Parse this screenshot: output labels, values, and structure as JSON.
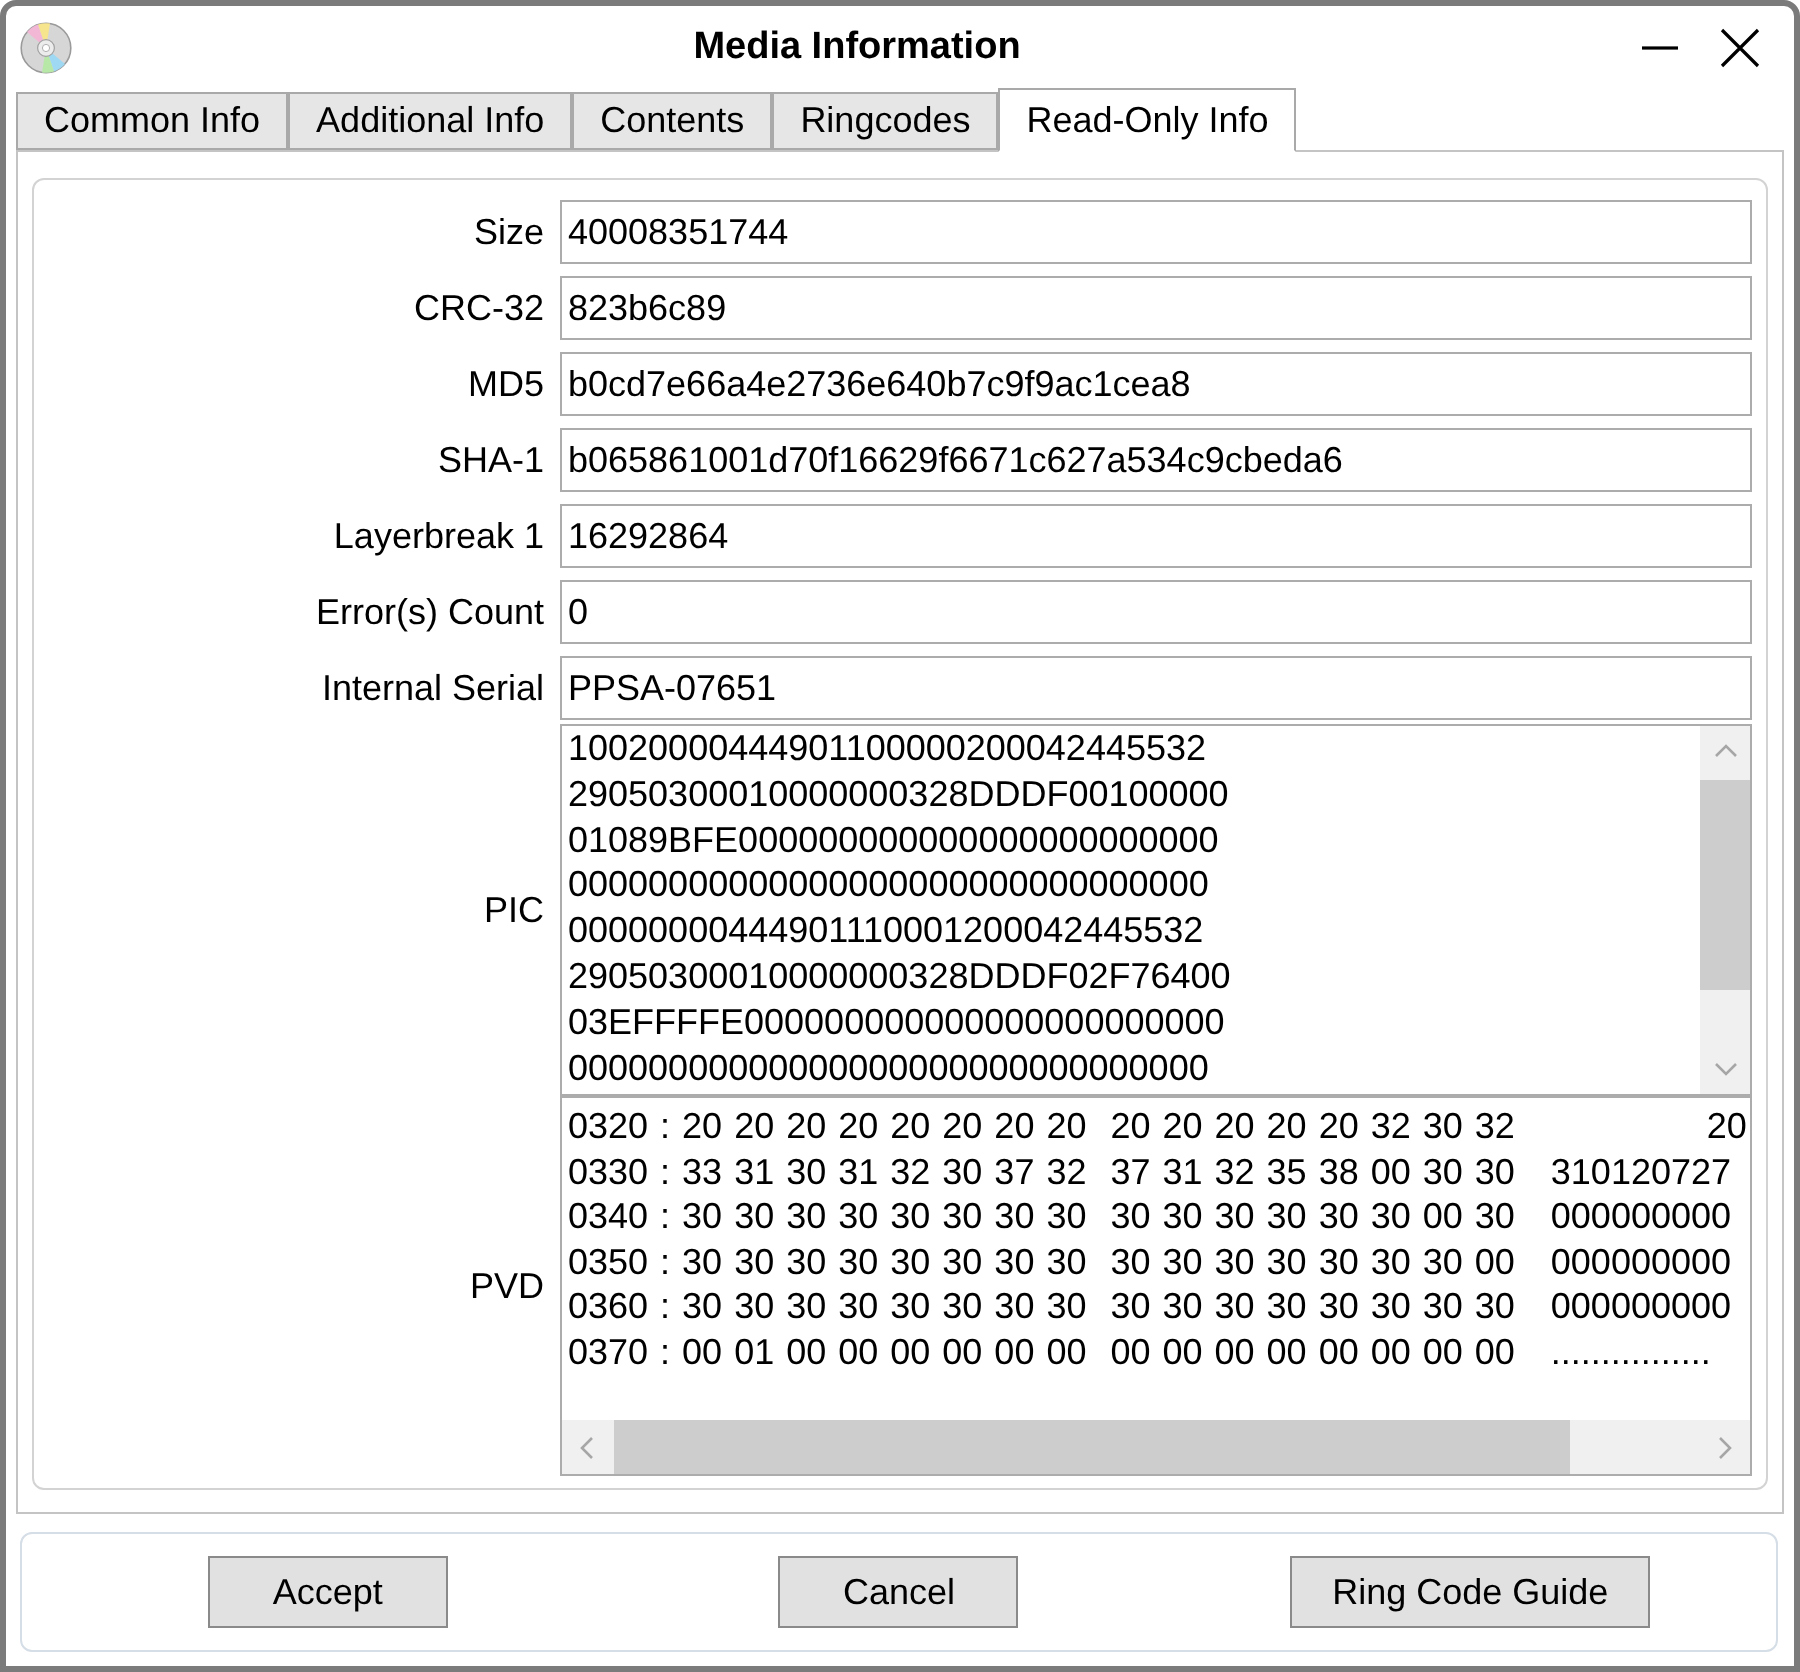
{
  "window": {
    "title": "Media Information"
  },
  "tabs": [
    {
      "label": "Common Info",
      "selected": false
    },
    {
      "label": "Additional Info",
      "selected": false
    },
    {
      "label": "Contents",
      "selected": false
    },
    {
      "label": "Ringcodes",
      "selected": false
    },
    {
      "label": "Read-Only Info",
      "selected": true
    }
  ],
  "fields": [
    {
      "label": "Size",
      "value": "40008351744"
    },
    {
      "label": "CRC-32",
      "value": "823b6c89"
    },
    {
      "label": "MD5",
      "value": "b0cd7e66a4e2736e640b7c9f9ac1cea8"
    },
    {
      "label": "SHA-1",
      "value": "b065861001d70f16629f6671c627a534c9cbeda6"
    },
    {
      "label": "Layerbreak 1",
      "value": "16292864"
    },
    {
      "label": "Error(s) Count",
      "value": "0"
    },
    {
      "label": "Internal Serial",
      "value": "PPSA-07651"
    }
  ],
  "pic": {
    "label": "PIC",
    "lines": [
      "10020000444901100000200042445532",
      "29050300010000000328DDDF00100000",
      "01089BFE000000000000000000000000",
      "00000000000000000000000000000000",
      "00000000444901110001200042445532",
      "29050300010000000328DDDF02F76400",
      "03EFFFFE000000000000000000000000",
      "00000000000000000000000000000000"
    ]
  },
  "pvd": {
    "label": "PVD",
    "rows": [
      "0320 : 20 20 20 20 20 20 20 20  20 20 20 20 20 32 30 32                20",
      "0330 : 33 31 30 31 32 30 37 32  37 31 32 35 38 00 30 30   310120727",
      "0340 : 30 30 30 30 30 30 30 30  30 30 30 30 30 30 00 30   000000000",
      "0350 : 30 30 30 30 30 30 30 30  30 30 30 30 30 30 30 00   000000000",
      "0360 : 30 30 30 30 30 30 30 30  30 30 30 30 30 30 30 30   000000000",
      "0370 : 00 01 00 00 00 00 00 00  00 00 00 00 00 00 00 00   ................"
    ]
  },
  "buttons": [
    {
      "label": "Accept"
    },
    {
      "label": "Cancel"
    },
    {
      "label": "Ring Code Guide"
    }
  ]
}
